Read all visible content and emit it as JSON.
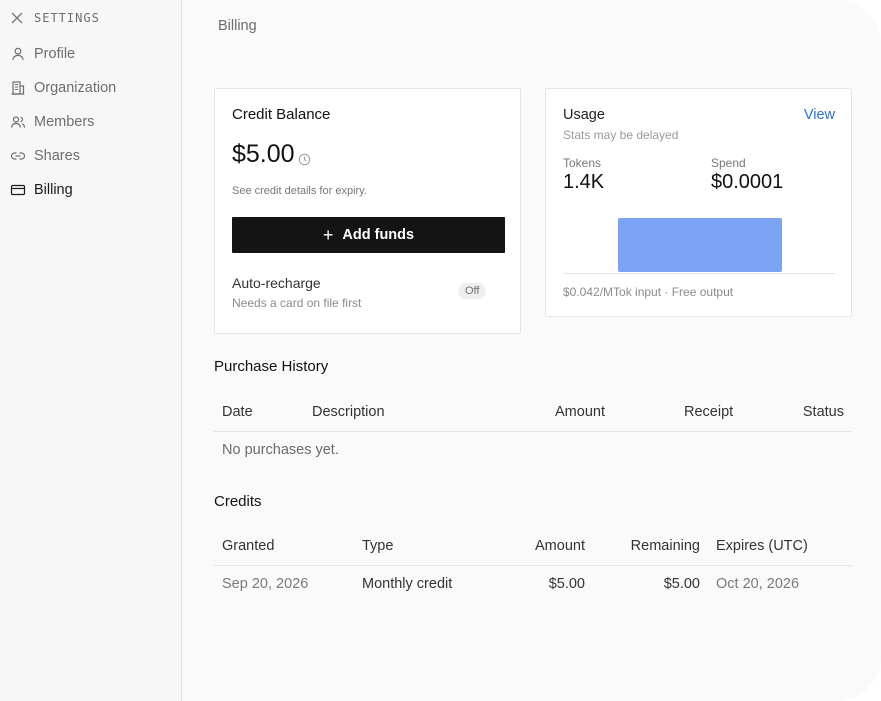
{
  "sidebar": {
    "heading": "SETTINGS",
    "items": [
      {
        "label": "Profile",
        "icon": "user-icon"
      },
      {
        "label": "Organization",
        "icon": "building-icon"
      },
      {
        "label": "Members",
        "icon": "users-icon"
      },
      {
        "label": "Shares",
        "icon": "link-icon"
      },
      {
        "label": "Billing",
        "icon": "credit-card-icon",
        "active": true
      }
    ]
  },
  "page": {
    "title": "Billing"
  },
  "credit_balance": {
    "title": "Credit Balance",
    "amount": "$5.00",
    "note": "See credit details for expiry.",
    "add_funds_label": "Add funds",
    "auto_recharge_label": "Auto-recharge",
    "auto_recharge_sub": "Needs a card on file first",
    "auto_recharge_state": "Off"
  },
  "usage": {
    "title": "Usage",
    "view_label": "View",
    "subtitle": "Stats may be delayed",
    "tokens_label": "Tokens",
    "tokens_value": "1.4K",
    "spend_label": "Spend",
    "spend_value": "$0.0001",
    "footer": "$0.042/MTok input · Free output",
    "bar_color": "#7ba4f5"
  },
  "purchase_history": {
    "title": "Purchase History",
    "columns": [
      "Date",
      "Description",
      "Amount",
      "Receipt",
      "Status"
    ],
    "empty_text": "No purchases yet."
  },
  "credits": {
    "title": "Credits",
    "columns": [
      "Granted",
      "Type",
      "Amount",
      "Remaining",
      "Expires (UTC)"
    ],
    "rows": [
      {
        "granted": "Sep 20, 2026",
        "type": "Monthly credit",
        "amount": "$5.00",
        "remaining": "$5.00",
        "expires": "Oct 20, 2026"
      }
    ]
  },
  "colors": {
    "accent": "#2a6fd6",
    "button": "#141414"
  }
}
